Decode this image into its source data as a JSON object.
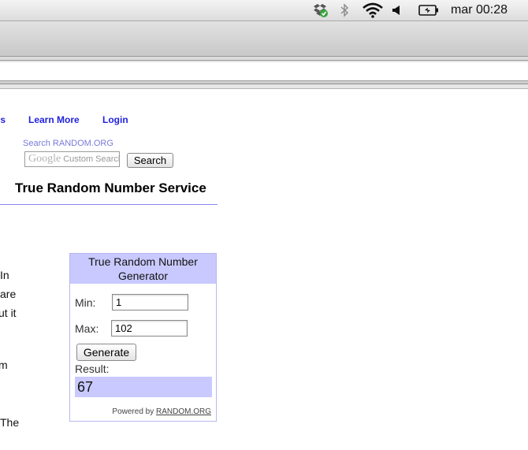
{
  "menubar": {
    "icons": [
      "dropbox-icon",
      "bluetooth-icon",
      "wifi-icon",
      "volume-icon",
      "battery-icon"
    ],
    "clock": "mar 00:28"
  },
  "nav": {
    "partial": "ls",
    "learn_more": "Learn More",
    "login": "Login"
  },
  "search": {
    "label": "Search RANDOM.ORG",
    "google_text": "Google",
    "placeholder": "Custom Search",
    "button": "Search"
  },
  "page": {
    "title": "True Random Number Service",
    "fragments": [
      "In",
      "are",
      "ut it",
      "m",
      "The"
    ]
  },
  "widget": {
    "title": "True Random Number Generator",
    "min_label": "Min:",
    "min_value": "1",
    "max_label": "Max:",
    "max_value": "102",
    "generate": "Generate",
    "result_label": "Result:",
    "result": "67",
    "powered_by": "Powered by",
    "powered_link": "RANDOM.ORG"
  },
  "colors": {
    "link": "#2222dd",
    "widget_accent": "#c9c9ff",
    "rule": "#8888ee"
  }
}
